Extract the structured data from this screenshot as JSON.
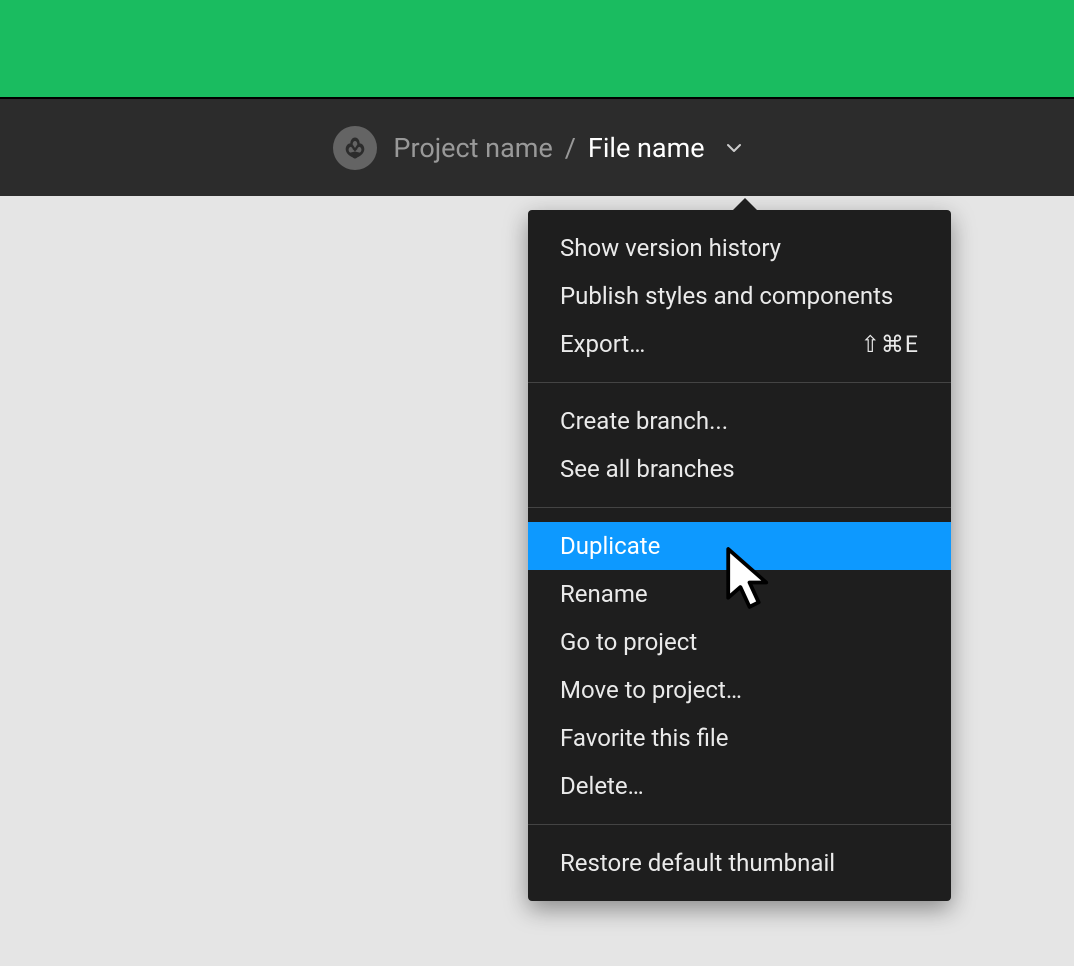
{
  "header": {
    "project_name": "Project name",
    "file_name": "File name"
  },
  "menu": {
    "section1": [
      {
        "label": "Show version history",
        "shortcut": ""
      },
      {
        "label": "Publish styles and components",
        "shortcut": ""
      },
      {
        "label": "Export…",
        "shortcut": "⇧⌘E"
      }
    ],
    "section2": [
      {
        "label": "Create branch...",
        "shortcut": ""
      },
      {
        "label": "See all branches",
        "shortcut": ""
      }
    ],
    "section3": [
      {
        "label": "Duplicate",
        "shortcut": "",
        "highlighted": true
      },
      {
        "label": "Rename",
        "shortcut": ""
      },
      {
        "label": "Go to project",
        "shortcut": ""
      },
      {
        "label": "Move to project…",
        "shortcut": ""
      },
      {
        "label": "Favorite this file",
        "shortcut": ""
      },
      {
        "label": "Delete…",
        "shortcut": ""
      }
    ],
    "section4": [
      {
        "label": "Restore default thumbnail",
        "shortcut": ""
      }
    ]
  }
}
